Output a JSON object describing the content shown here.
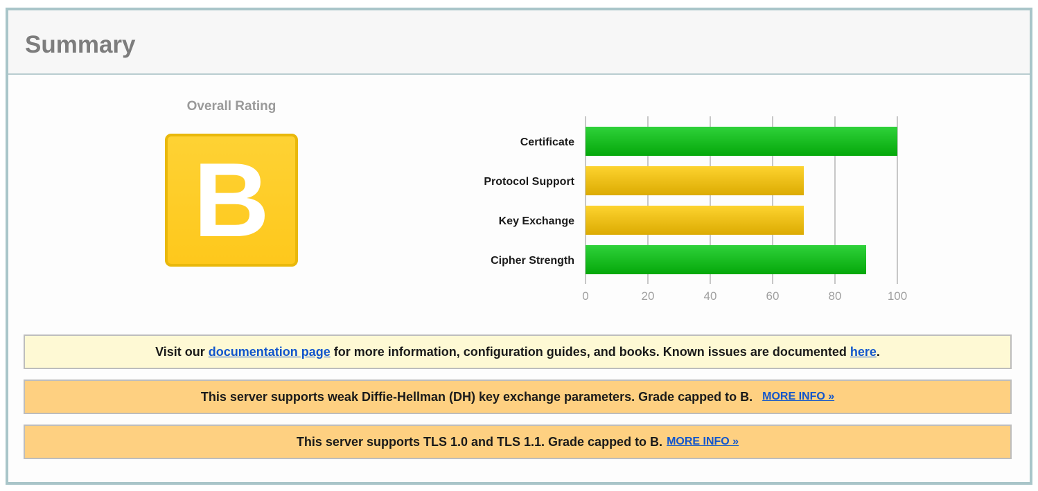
{
  "header": {
    "title": "Summary"
  },
  "rating": {
    "label": "Overall Rating",
    "grade": "B"
  },
  "colors": {
    "good": "#14b814",
    "warn": "#e6b60e",
    "grade_bg": "#fec81c"
  },
  "chart_data": {
    "type": "bar",
    "orientation": "horizontal",
    "categories": [
      "Certificate",
      "Protocol Support",
      "Key Exchange",
      "Cipher Strength"
    ],
    "values": [
      100,
      70,
      70,
      90
    ],
    "bar_colors": [
      "green",
      "yellow",
      "yellow",
      "green"
    ],
    "xlim": [
      0,
      100
    ],
    "xticks": [
      "0",
      "20",
      "40",
      "60",
      "80",
      "100"
    ],
    "grid": true
  },
  "notices": {
    "doc": {
      "text_before": "Visit our ",
      "link1": "documentation page",
      "text_mid": " for more information, configuration guides, and books. Known issues are documented ",
      "link2": "here",
      "text_after": "."
    },
    "dh": {
      "text": "This server supports weak Diffie-Hellman (DH) key exchange parameters. Grade capped to B.",
      "link": "MORE INFO »"
    },
    "tls": {
      "text": "This server supports TLS 1.0 and TLS 1.1. Grade capped to B.",
      "link": "MORE INFO »"
    }
  }
}
